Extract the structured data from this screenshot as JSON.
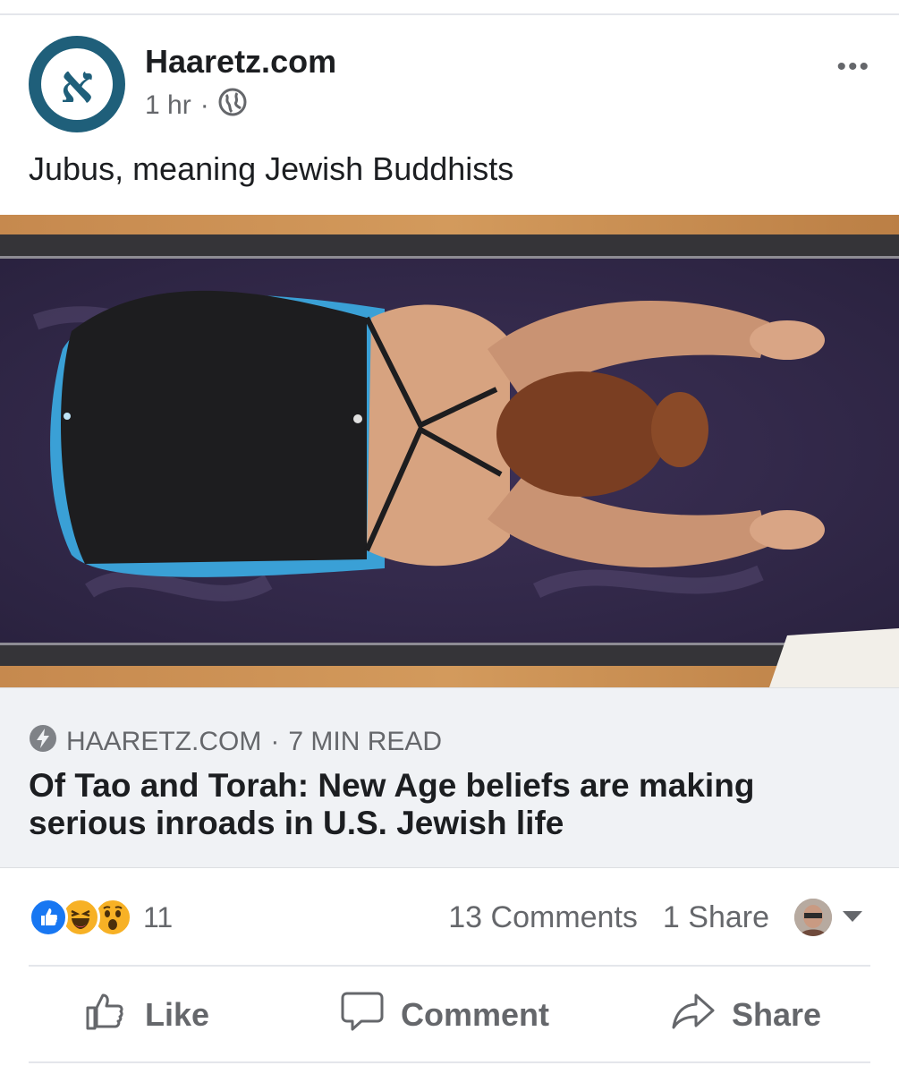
{
  "post": {
    "page_name": "Haaretz.com",
    "time": "1 hr",
    "separator": "·",
    "audience_icon": "globe-icon",
    "more_label": "•••",
    "text": "Jubus, meaning Jewish Buddhists",
    "logo_letter": "א"
  },
  "link": {
    "source": "HAARETZ.COM",
    "separator": "·",
    "read_time": "7 MIN READ",
    "title": "Of Tao and Torah: New Age beliefs are making serious inroads in U.S. Jewish life",
    "instant_icon": "lightning-bolt-icon"
  },
  "engagement": {
    "reaction_icons": [
      "like-reaction-icon",
      "haha-reaction-icon",
      "wow-reaction-icon"
    ],
    "reaction_count": "11",
    "comments": "13 Comments",
    "shares": "1 Share"
  },
  "actions": {
    "like": "Like",
    "comment": "Comment",
    "share": "Share"
  },
  "colors": {
    "facebook_blue": "#1877f2",
    "text_primary": "#1c1e21",
    "text_secondary": "#65676b",
    "haaretz_teal": "#1f5f7a"
  }
}
